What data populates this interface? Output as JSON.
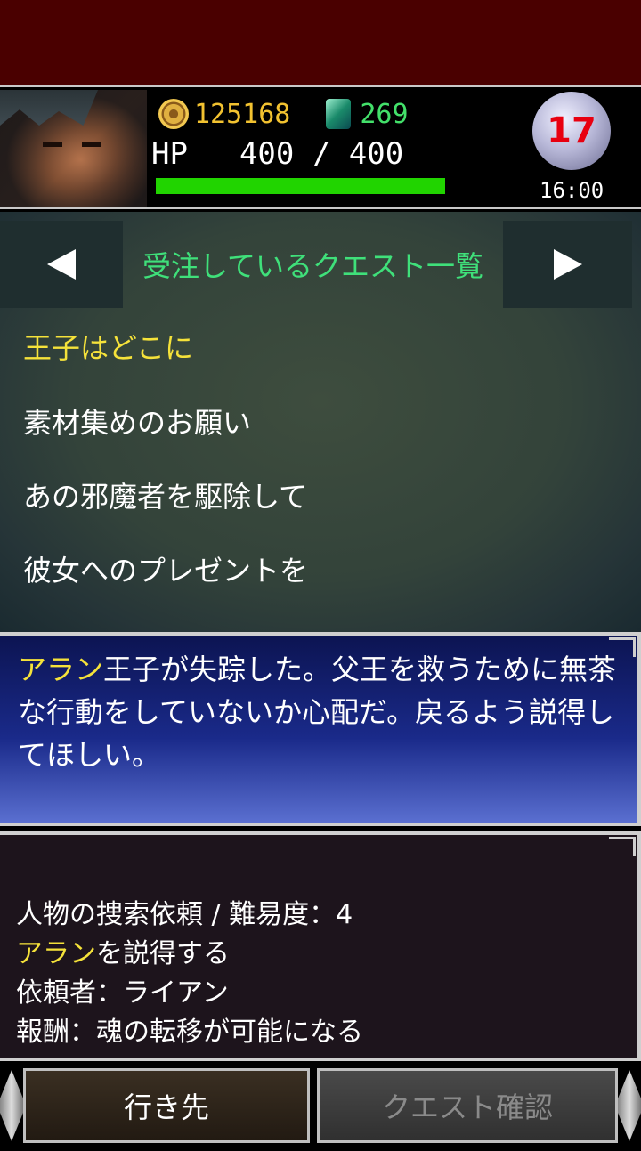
{
  "status": {
    "coins": "125168",
    "gems": "269",
    "hp_label": "HP",
    "hp_value": "400 / 400",
    "hp_fraction": 1.0,
    "day": "17",
    "time": "16:00"
  },
  "quest_list": {
    "title": "受注しているクエスト一覧",
    "items": [
      "王子はどこに",
      "素材集めのお願い",
      "あの邪魔者を駆除して",
      "彼女へのプレゼントを"
    ],
    "selected_index": 0
  },
  "description": {
    "highlight": "アラン",
    "text_rest": "王子が失踪した。父王を救うために無茶な行動をしていないか心配だ。戻るよう説得してほしい。"
  },
  "detail": {
    "line1": "人物の捜索依頼 / 難易度：4",
    "line2_highlight": "アラン",
    "line2_rest": "を説得する",
    "line3": "依頼者：ライアン",
    "line4": "報酬：魂の転移が可能になる"
  },
  "buttons": {
    "go": "行き先",
    "confirm": "クエスト確認"
  },
  "colors": {
    "highlight": "#f5e23a",
    "title_green": "#3fe07a",
    "hp_green": "#21d400",
    "coin_gold": "#f2c230"
  }
}
